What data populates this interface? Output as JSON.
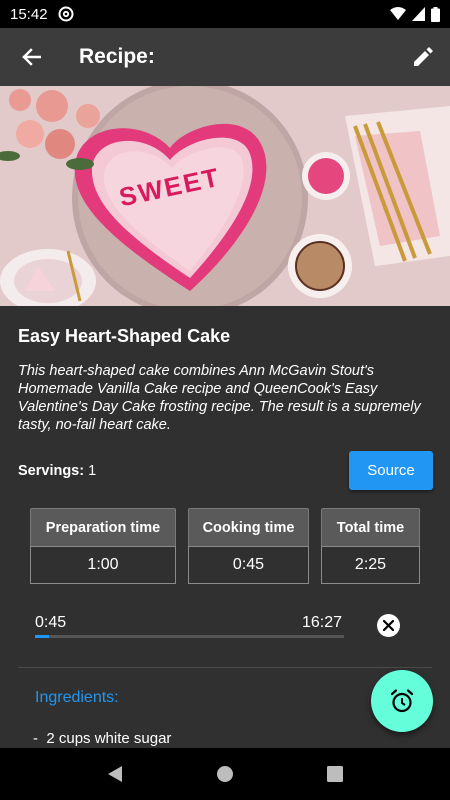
{
  "status_bar": {
    "time": "15:42"
  },
  "app_bar": {
    "title": "Recipe:"
  },
  "recipe": {
    "title": "Easy Heart-Shaped Cake",
    "description": "This heart-shaped cake combines Ann McGavin Stout's Homemade Vanilla Cake recipe and QueenCook's Easy Valentine's Day Cake frosting recipe. The result is a supremely tasty, no-fail heart cake.",
    "servings_label": "Servings:",
    "servings_value": "1",
    "source_label": "Source",
    "hero_text": "SWEET"
  },
  "times": [
    {
      "label": "Preparation time",
      "value": "1:00"
    },
    {
      "label": "Cooking time",
      "value": "0:45"
    },
    {
      "label": "Total time",
      "value": "2:25"
    }
  ],
  "player": {
    "current": "0:45",
    "total": "16:27",
    "progress": 0.046
  },
  "ingredients": {
    "heading": "Ingredients:",
    "items": [
      "2 cups white sugar"
    ]
  },
  "icons": {
    "status": [
      "at-sign-icon",
      "wifi-icon",
      "cell-signal-icon",
      "battery-icon"
    ],
    "app_bar": [
      "back-arrow-icon",
      "edit-pencil-icon"
    ],
    "fab": "alarm-clock-icon",
    "nav": [
      "back-triangle-icon",
      "home-circle-icon",
      "recents-square-icon"
    ]
  },
  "colors": {
    "accent": "#2196f3",
    "fab": "#64ffda",
    "background": "#303030",
    "app_bar": "#3c3c3c"
  }
}
